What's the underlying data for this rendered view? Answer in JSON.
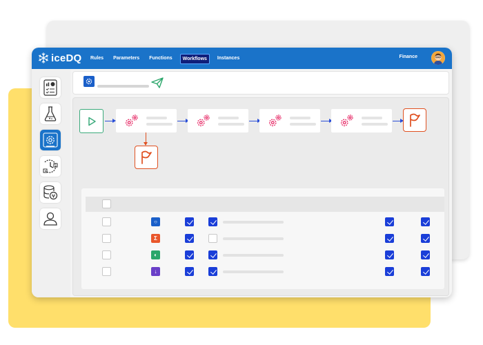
{
  "app": {
    "logo_text": "iceDQ",
    "brand_color": "#1a73c9",
    "nav": [
      {
        "label": "Rules",
        "active": false
      },
      {
        "label": "Parameters",
        "active": false
      },
      {
        "label": "Functions",
        "active": false
      },
      {
        "label": "Workflows",
        "active": true
      },
      {
        "label": "Instances",
        "active": false
      }
    ],
    "workspace": "Finance",
    "avatar_icon": "user-avatar"
  },
  "sidebar": {
    "items": [
      {
        "icon": "dashboard-checklist-icon",
        "active": false
      },
      {
        "icon": "flask-icon",
        "active": false
      },
      {
        "icon": "workflow-gear-icon",
        "active": true
      },
      {
        "icon": "schedule-timer-icon",
        "active": false
      },
      {
        "icon": "database-connection-icon",
        "active": false
      },
      {
        "icon": "user-icon",
        "active": false
      }
    ]
  },
  "workflow_header": {
    "icon": "workflow-icon",
    "action_icon": "send-icon"
  },
  "workflow": {
    "start_icon": "play-icon",
    "task_icon": "gears-icon",
    "task_count": 4,
    "end_icon": "flag-icon",
    "colors": {
      "start": "#3aaa7b",
      "connector": "#2a4fd8",
      "flag": "#e05020",
      "gear": "#e8336d"
    }
  },
  "table": {
    "rows": [
      {
        "type_icon": "check-rule-icon",
        "type_color": "#1a5fc9",
        "checks": [
          true,
          true,
          true,
          true
        ]
      },
      {
        "type_icon": "sum-rule-icon",
        "type_color": "#e9562b",
        "checks": [
          true,
          false,
          true,
          true
        ]
      },
      {
        "type_icon": "reconciliation-rule-icon",
        "type_color": "#2aa66a",
        "checks": [
          true,
          true,
          true,
          true
        ]
      },
      {
        "type_icon": "download-rule-icon",
        "type_color": "#6a3fc8",
        "checks": [
          true,
          true,
          true,
          true
        ]
      }
    ],
    "type_glyphs": [
      "○",
      "Σ",
      "◐",
      "↓"
    ]
  }
}
